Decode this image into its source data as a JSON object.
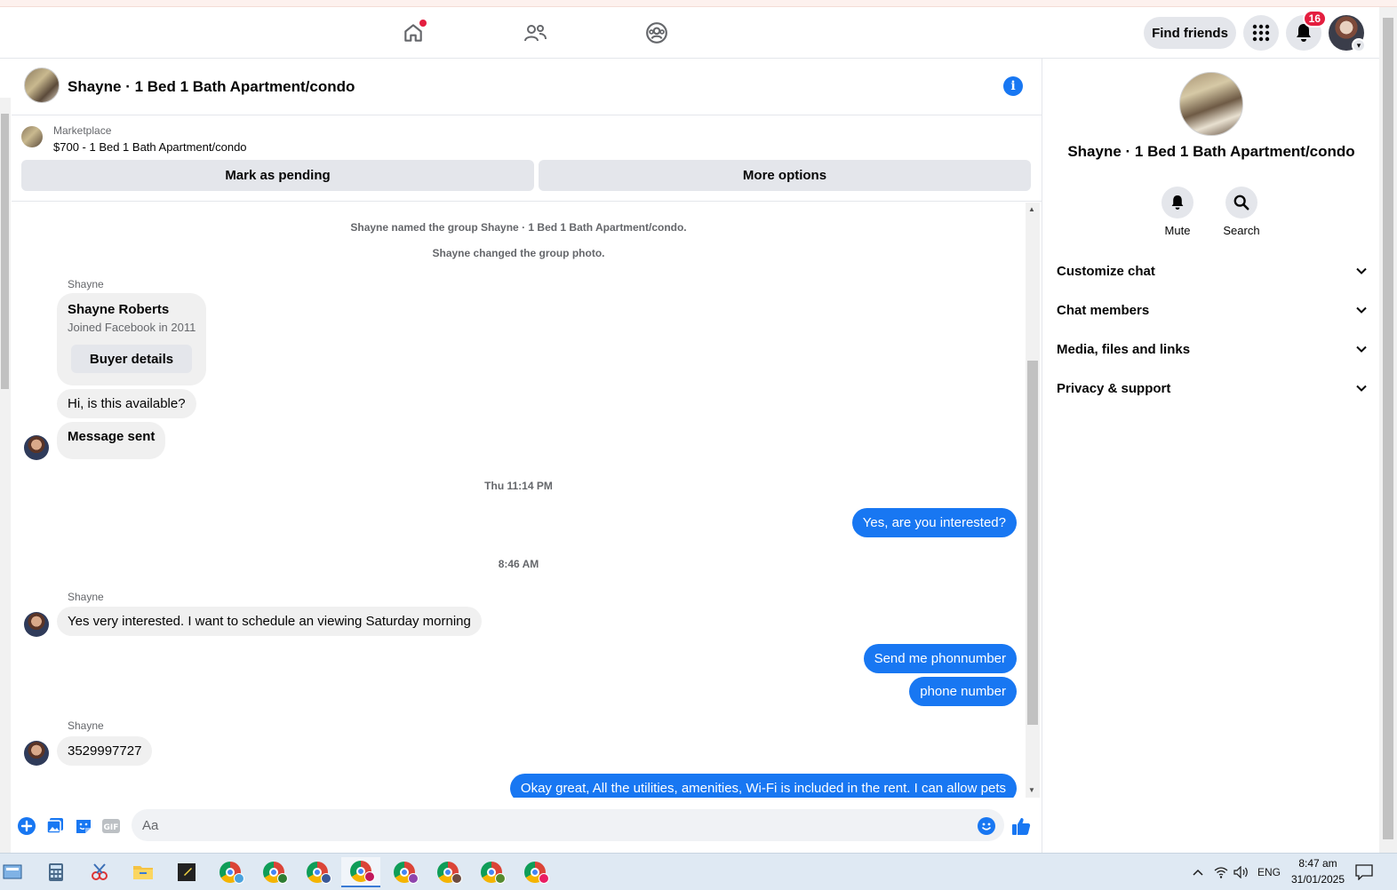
{
  "nav": {
    "find_friends": "Find friends",
    "notif_count": "16"
  },
  "chat": {
    "title": "Shayne · 1 Bed 1 Bath Apartment/condo"
  },
  "marketplace": {
    "label": "Marketplace",
    "listing": "$700 - 1 Bed 1 Bath Apartment/condo",
    "pending_label": "Mark as pending",
    "more_label": "More options"
  },
  "messages": {
    "sys_named": "Shayne named the group Shayne · 1 Bed 1 Bath Apartment/condo.",
    "sys_photo": "Shayne changed the group photo.",
    "sender": "Shayne",
    "card_name": "Shayne Roberts",
    "card_sub": "Joined Facebook in 2011",
    "card_button": "Buyer details",
    "m1": "Hi, is this available?",
    "m2": "Message sent",
    "time1": "Thu 11:14 PM",
    "m3": "Yes, are you interested?",
    "time2": "8:46 AM",
    "m4": "Yes very interested. I want to schedule an viewing Saturday morning",
    "m5": "Send me phonnumber",
    "m6": "phone number",
    "m7": "3529997727",
    "m8": "Okay great, All the utilities, amenities, Wi-Fi is included in the rent. I can allow pets"
  },
  "composer": {
    "placeholder": "Aa"
  },
  "panel": {
    "title": "Shayne · 1 Bed 1 Bath Apartment/condo",
    "mute": "Mute",
    "search": "Search",
    "rows": [
      "Customize chat",
      "Chat members",
      "Media, files and links",
      "Privacy & support"
    ]
  },
  "taskbar": {
    "lang": "ENG",
    "time": "8:47 am",
    "date": "31/01/2025"
  },
  "colors": {
    "accent": "#1877f2",
    "badge": "#e41e3f",
    "bubble_in": "#f0f0f0"
  }
}
